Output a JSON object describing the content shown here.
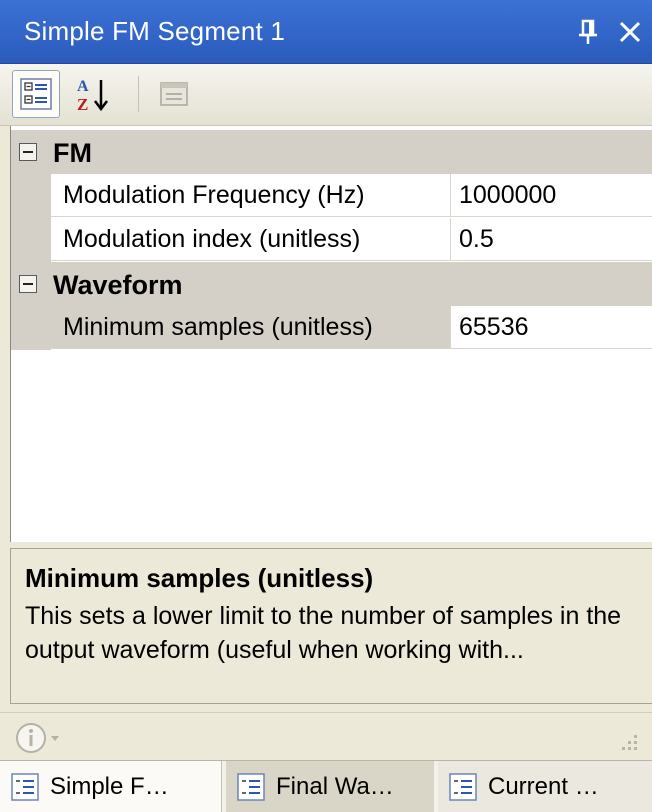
{
  "window": {
    "title": "Simple FM Segment 1"
  },
  "toolbar": {
    "buttons": [
      "categorized-icon",
      "alphabetical-sort-icon",
      "property-pages-icon"
    ]
  },
  "grid": {
    "categories": [
      {
        "label": "FM",
        "properties": [
          {
            "name": "Modulation Frequency (Hz)",
            "value": "1000000"
          },
          {
            "name": "Modulation index (unitless)",
            "value": "0.5"
          }
        ]
      },
      {
        "label": "Waveform",
        "properties": [
          {
            "name": "Minimum samples (unitless)",
            "value": "65536",
            "selected": true
          }
        ]
      }
    ]
  },
  "help": {
    "title": "Minimum samples (unitless)",
    "description": "This sets a lower limit to the number of samples in the output waveform (useful when working with..."
  },
  "tabs": [
    {
      "label": "Simple F…",
      "active": true
    },
    {
      "label": "Final Wa…",
      "active": false
    },
    {
      "label": "Current …",
      "active": false
    }
  ],
  "colors": {
    "titlebar": "#2f63c8",
    "category_bg": "#d4d0c8",
    "panel_bg": "#ece9d8"
  }
}
